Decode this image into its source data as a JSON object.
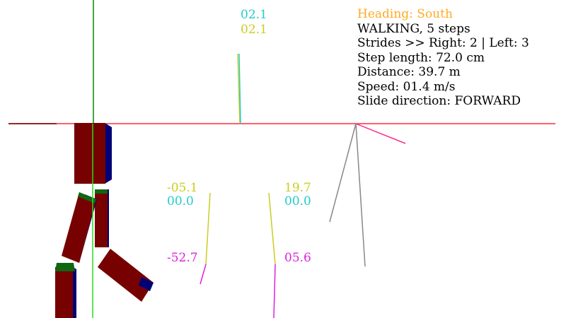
{
  "colors": {
    "background": "#ffffff",
    "horizon": "#ff2a3a",
    "vertical_axis": "#008800",
    "foot_axis": "#22dd22",
    "cyan": "#22cccc",
    "yellow": "#cccc22",
    "magenta": "#dd22dd",
    "orange": "#ffaa22",
    "gray": "#888888",
    "body_red": "#770000",
    "body_blue": "#000077",
    "joint_green": "#116611",
    "text": "#000000"
  },
  "info": {
    "heading": "Heading: South",
    "state": "WALKING, 5 steps",
    "strides": "Strides >> Right: 2 | Left: 3",
    "step_length": "Step length: 72.0 cm",
    "distance": "Distance: 39.7 m",
    "speed": "Speed: 01.4 m/s",
    "slide_direction": "Slide direction: FORWARD"
  },
  "readouts": {
    "top_cyan": "02.1",
    "top_yellow": "02.1",
    "left_yellow": "-05.1",
    "left_cyan": "00.0",
    "right_yellow": "19.7",
    "right_cyan": "00.0",
    "left_magenta": "-52.7",
    "right_magenta": "05.6"
  }
}
